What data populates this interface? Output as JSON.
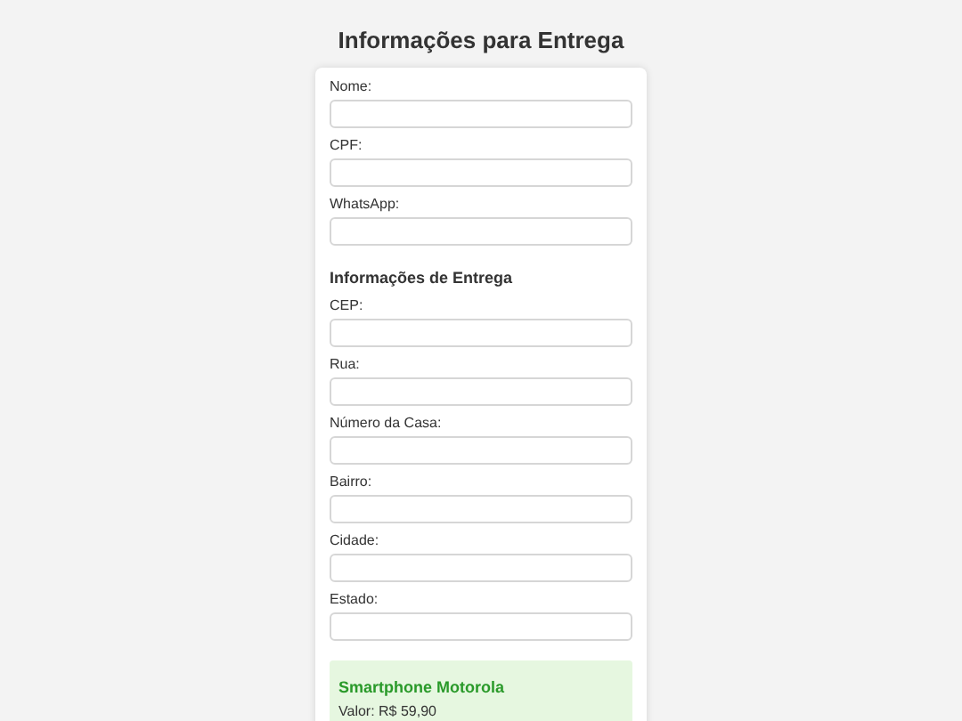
{
  "title": "Informações para Entrega",
  "personal_fields": [
    {
      "label": "Nome:"
    },
    {
      "label": "CPF:"
    },
    {
      "label": "WhatsApp:"
    }
  ],
  "delivery": {
    "heading": "Informações de Entrega",
    "fields": [
      {
        "label": "CEP:"
      },
      {
        "label": "Rua:"
      },
      {
        "label": "Número da Casa:"
      },
      {
        "label": "Bairro:"
      },
      {
        "label": "Cidade:"
      },
      {
        "label": "Estado:"
      }
    ]
  },
  "product": {
    "name": "Smartphone Motorola",
    "price": "Valor: R$ 59,90"
  }
}
